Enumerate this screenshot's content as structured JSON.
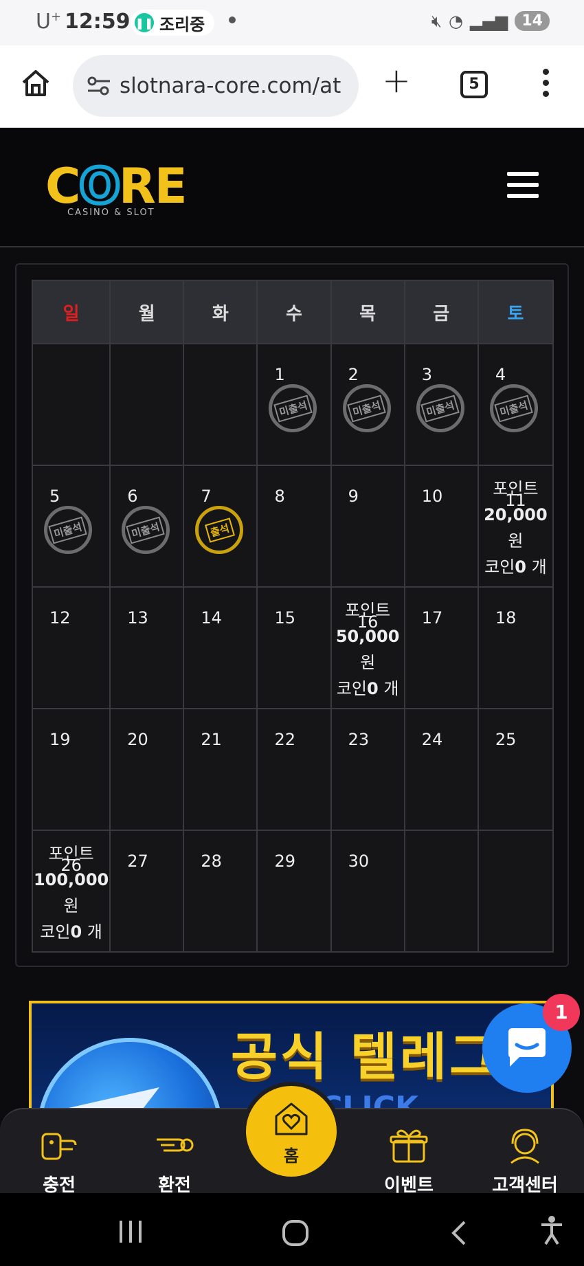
{
  "status_bar": {
    "carrier": "U",
    "carrier_sup": "+",
    "time": "12:59",
    "cooking_label": "조리중",
    "battery": "14"
  },
  "browser": {
    "url": "slotnara-core.com/at",
    "tab_count": "5"
  },
  "site": {
    "logo_text_a": "C",
    "logo_text_b": "O",
    "logo_text_c": "RE",
    "logo_tagline": "CASINO & SLOT"
  },
  "calendar": {
    "weekdays": [
      "일",
      "월",
      "화",
      "수",
      "목",
      "금",
      "토"
    ],
    "stamp_absent": "미출석",
    "stamp_present": "출석",
    "weeks": [
      [
        {
          "day": ""
        },
        {
          "day": ""
        },
        {
          "day": ""
        },
        {
          "day": "1",
          "stamp": "absent"
        },
        {
          "day": "2",
          "stamp": "absent"
        },
        {
          "day": "3",
          "stamp": "absent"
        },
        {
          "day": "4",
          "stamp": "absent"
        }
      ],
      [
        {
          "day": "5",
          "stamp": "absent"
        },
        {
          "day": "6",
          "stamp": "absent"
        },
        {
          "day": "7",
          "stamp": "present"
        },
        {
          "day": "8"
        },
        {
          "day": "9"
        },
        {
          "day": "10"
        },
        {
          "day": "11",
          "reward": {
            "label": "포인트",
            "amount": "20,000",
            "unit": "원",
            "coin_prefix": "코인",
            "coin_value": "0",
            "coin_unit": " 개"
          }
        }
      ],
      [
        {
          "day": "12"
        },
        {
          "day": "13"
        },
        {
          "day": "14"
        },
        {
          "day": "15"
        },
        {
          "day": "16",
          "reward": {
            "label": "포인트",
            "amount": "50,000",
            "unit": "원",
            "coin_prefix": "코인",
            "coin_value": "0",
            "coin_unit": " 개"
          }
        },
        {
          "day": "17"
        },
        {
          "day": "18"
        }
      ],
      [
        {
          "day": "19"
        },
        {
          "day": "20"
        },
        {
          "day": "21"
        },
        {
          "day": "22"
        },
        {
          "day": "23"
        },
        {
          "day": "24"
        },
        {
          "day": "25"
        }
      ],
      [
        {
          "day": "26",
          "reward": {
            "label": "포인트",
            "amount": "100,000",
            "unit": "원",
            "coin_prefix": "코인",
            "coin_value": "0",
            "coin_unit": " 개"
          }
        },
        {
          "day": "27"
        },
        {
          "day": "28"
        },
        {
          "day": "29"
        },
        {
          "day": "30"
        },
        {
          "day": ""
        },
        {
          "day": ""
        }
      ]
    ]
  },
  "banner": {
    "title": "공식 텔레그",
    "subtitle": "CLICK"
  },
  "chat": {
    "badge": "1"
  },
  "bottom_nav": {
    "charge": "충전",
    "exchange": "환전",
    "home": "홈",
    "event": "이벤트",
    "support": "고객센터"
  },
  "colors": {
    "sunday": "#e02020",
    "saturday": "#3aa3ee",
    "accent_gold": "#f5bf0e",
    "chat_blue": "#1f7ef0"
  }
}
